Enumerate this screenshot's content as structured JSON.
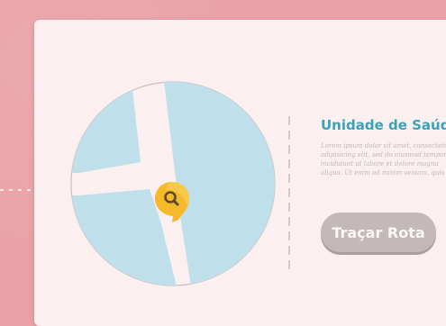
{
  "card": {
    "title": "Unidade de Saúde",
    "description": "Lorem ipsum dolor sit amet, consectetur adipisicing elit, sed do eiusmod tempor incididunt ut labore et dolore magna aliqua. Ut enim ad minim veniam, quis",
    "button_label": "Traçar Rota"
  },
  "map": {
    "marker_icon": "search-icon"
  },
  "colors": {
    "background": "#e9a3a7",
    "card": "#fbeff0",
    "accent": "#3aa3b6",
    "map_water": "#bfe0ea",
    "marker": "#f6b92c",
    "button": "#c3b9ba"
  }
}
